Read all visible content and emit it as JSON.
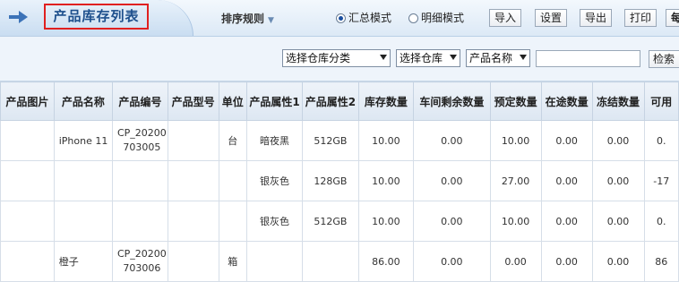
{
  "header": {
    "title": "产品库存列表",
    "sort_label": "排序规则",
    "modes": [
      {
        "label": "汇总模式",
        "selected": true
      },
      {
        "label": "明细模式",
        "selected": false
      }
    ],
    "buttons": [
      "导入",
      "设置",
      "导出",
      "打印",
      "每"
    ]
  },
  "filters": {
    "warehouse_category": "选择仓库分类",
    "warehouse": "选择仓库",
    "field": "产品名称",
    "search_value": "",
    "search_label": "检索"
  },
  "table": {
    "columns": [
      "产品图片",
      "产品名称",
      "产品编号",
      "产品型号",
      "单位",
      "产品属性1",
      "产品属性2",
      "库存数量",
      "车间剩余数量",
      "预定数量",
      "在途数量",
      "冻结数量",
      "可用"
    ],
    "rows": [
      {
        "image": "",
        "name": "iPhone 11",
        "code": "CP_20200703005",
        "model": "",
        "unit": "台",
        "attr1": "暗夜黑",
        "attr2": "512GB",
        "stock": "10.00",
        "workshop": "0.00",
        "reserved": "10.00",
        "transit": "0.00",
        "frozen": "0.00",
        "available": "0."
      },
      {
        "image": "",
        "name": "",
        "code": "",
        "model": "",
        "unit": "",
        "attr1": "银灰色",
        "attr2": "128GB",
        "stock": "10.00",
        "workshop": "0.00",
        "reserved": "27.00",
        "transit": "0.00",
        "frozen": "0.00",
        "available": "-17"
      },
      {
        "image": "",
        "name": "",
        "code": "",
        "model": "",
        "unit": "",
        "attr1": "银灰色",
        "attr2": "512GB",
        "stock": "10.00",
        "workshop": "0.00",
        "reserved": "10.00",
        "transit": "0.00",
        "frozen": "0.00",
        "available": "0."
      },
      {
        "image": "",
        "name": "橙子",
        "code": "CP_20200703006",
        "model": "",
        "unit": "箱",
        "attr1": "",
        "attr2": "",
        "stock": "86.00",
        "workshop": "0.00",
        "reserved": "0.00",
        "transit": "0.00",
        "frozen": "0.00",
        "available": "86"
      }
    ]
  },
  "icons": {
    "title_marker": "arrow-right-icon",
    "sort_caret": "chevron-down-icon"
  },
  "colors": {
    "title_text": "#1d4f8c",
    "title_highlight": "#e02020",
    "header_bg": "#dde7f2"
  }
}
